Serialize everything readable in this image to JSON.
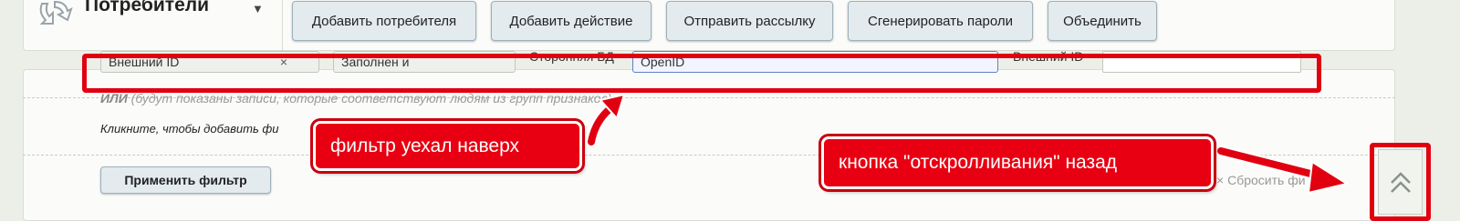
{
  "header": {
    "title": "Потребители",
    "caret": "▼",
    "buttons": {
      "add_consumer": "Добавить потребителя",
      "add_action": "Добавить действие",
      "send_mailing": "Отправить рассылку",
      "generate_passwords": "Сгенерировать пароли",
      "merge": "Объединить"
    }
  },
  "filter": {
    "row": {
      "select1": "Внешний ID",
      "select1_clear": "×",
      "select2": "Заполнен и",
      "source_label": "Сторонняя БД",
      "source_value": "OpenID",
      "external_id_label": "Внешний ID",
      "external_id_value": ""
    },
    "or_keyword": "ИЛИ",
    "or_hint": "(будут показаны записи, которые соответствуют людям из групп признаков)",
    "click_to_add": "Кликните, чтобы добавить фи",
    "apply_button": "Применить фильтр",
    "reset_symbol": "×",
    "reset_label": "Сбросить фи"
  },
  "annotations": {
    "filter_moved": "фильтр уехал наверх",
    "scroll_back_button": "кнопка \"отскролливания\" назад"
  },
  "colors": {
    "annotation_red": "#e1000f",
    "button_bg": "#e3ebef",
    "page_bg": "#ecefe8"
  },
  "icons": {
    "logo": "sync-arrows-icon",
    "scroll_top": "double-chevron-up-icon"
  }
}
